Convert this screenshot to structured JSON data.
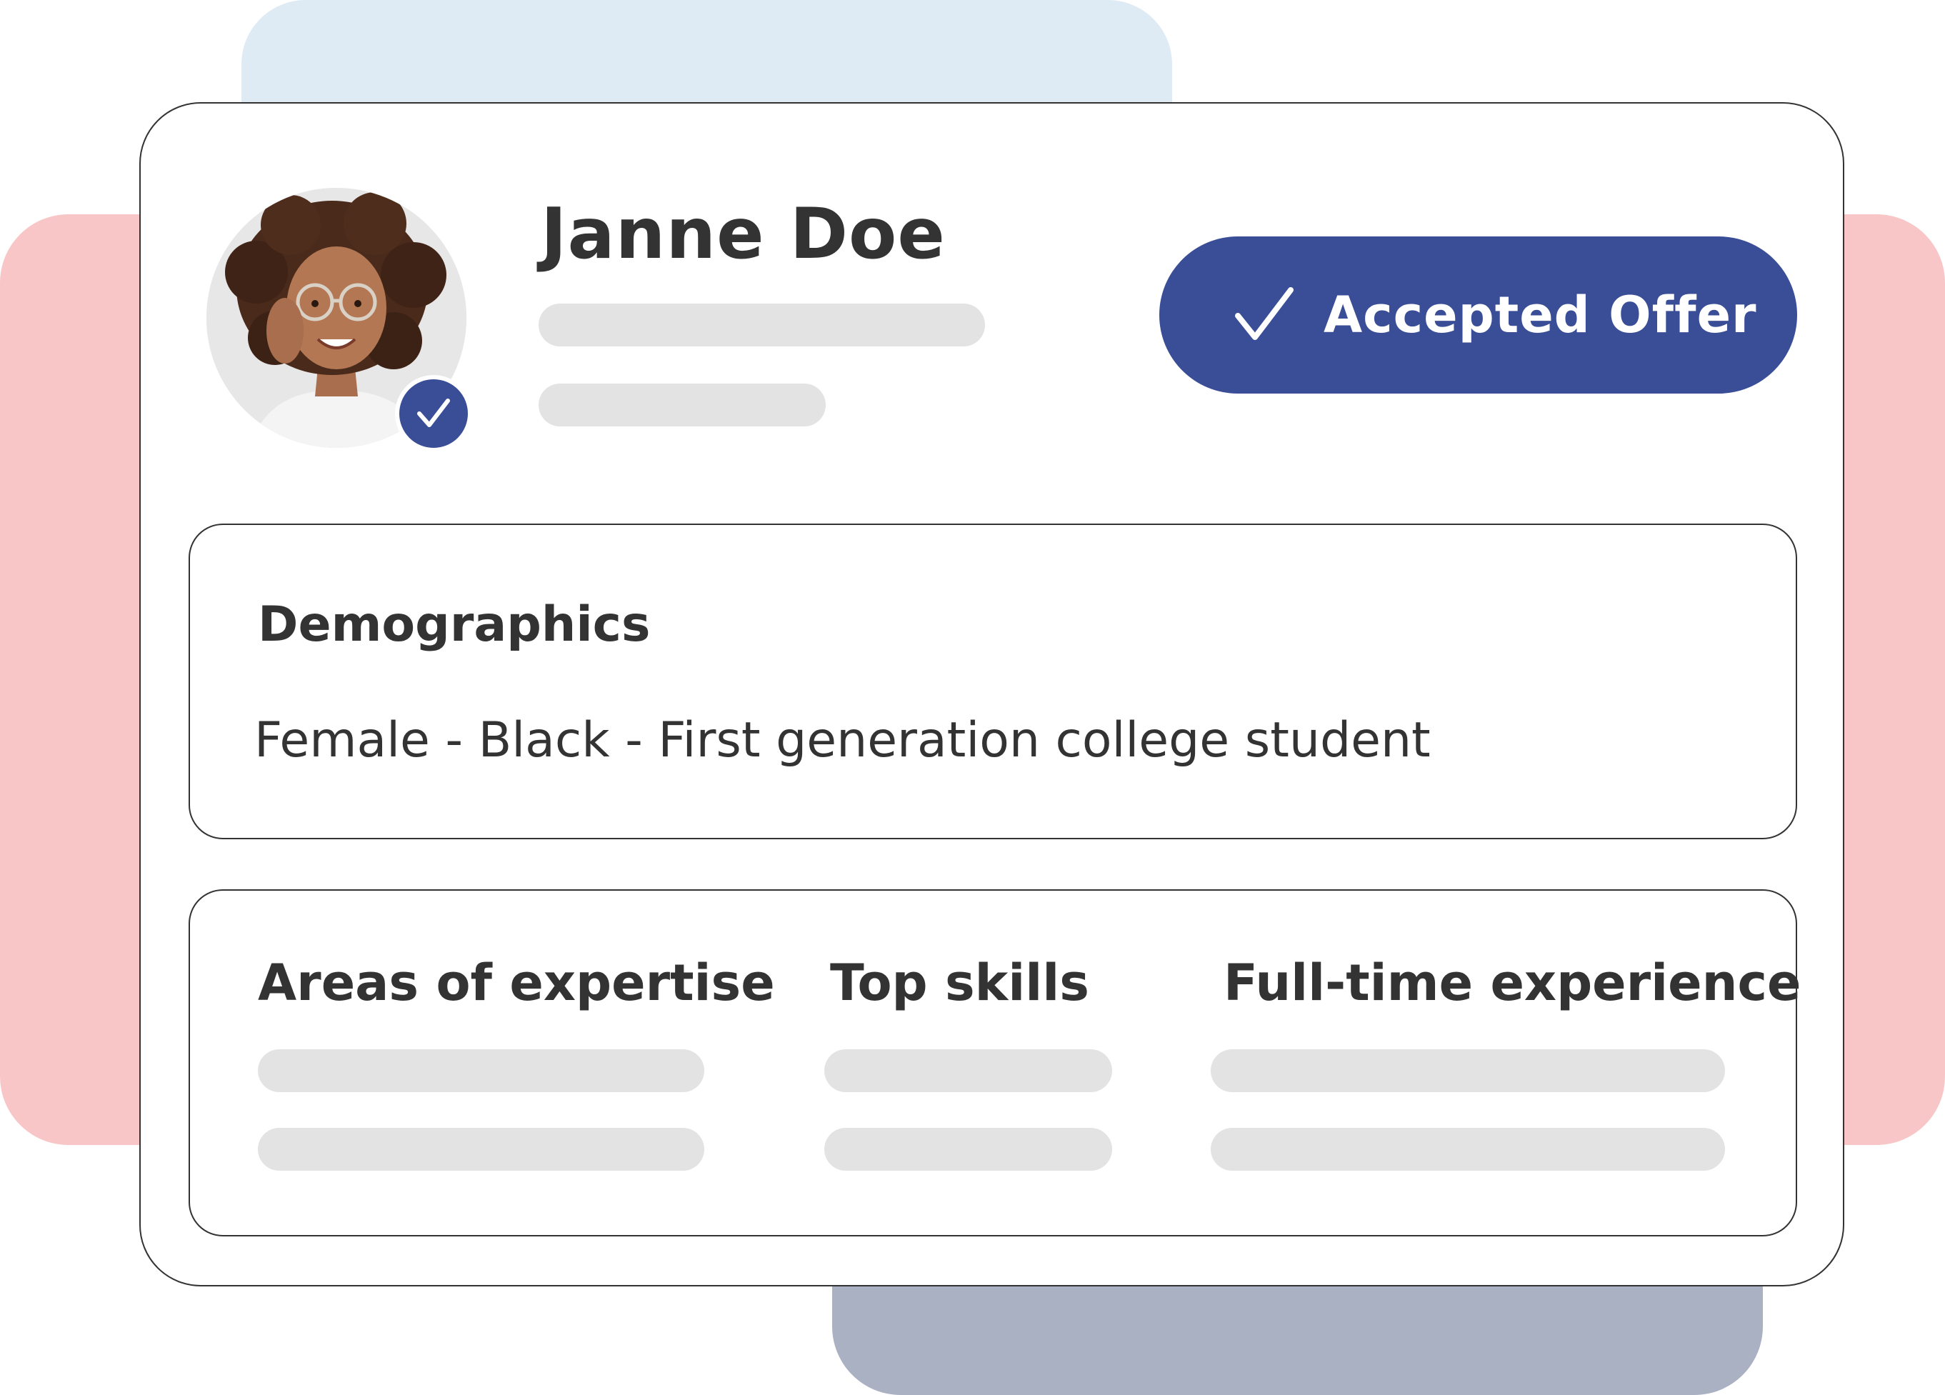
{
  "profile": {
    "name": "Janne Doe",
    "photo_alt": "Profile photo of Janne Doe",
    "verified_icon": "check-icon"
  },
  "status": {
    "label": "Accepted Offer",
    "icon": "check-icon",
    "color": "#3a4d97"
  },
  "demographics": {
    "title": "Demographics",
    "value": "Female - Black - First generation college student"
  },
  "skills": {
    "columns": [
      {
        "heading": "Areas of expertise"
      },
      {
        "heading": "Top skills"
      },
      {
        "heading": "Full-time experience"
      }
    ]
  },
  "colors": {
    "accent": "#3a4d97",
    "placeholder": "#e3e3e3",
    "text": "#333333",
    "deco_blue": "#deebf4",
    "deco_pink": "#f8c6c6",
    "deco_slate": "#aab1c3"
  }
}
